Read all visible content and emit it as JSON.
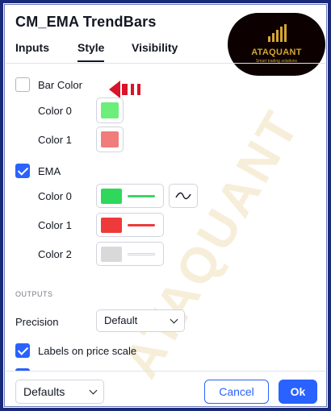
{
  "dialog": {
    "title": "CM_EMA TrendBars"
  },
  "tabs": [
    {
      "label": "Inputs",
      "active": false
    },
    {
      "label": "Style",
      "active": true
    },
    {
      "label": "Visibility",
      "active": false
    }
  ],
  "logo": {
    "name": "ATAQUANT",
    "tagline": "Smart trading solutions"
  },
  "watermark": "ATAQUANT",
  "bar_color": {
    "label": "Bar Color",
    "checked": false,
    "colors": [
      {
        "label": "Color 0",
        "value": "#6bef7a"
      },
      {
        "label": "Color 1",
        "value": "#f07c7c"
      }
    ]
  },
  "ema": {
    "label": "EMA",
    "checked": true,
    "colors": [
      {
        "label": "Color 0",
        "value": "#2ed85a",
        "line": "#3cd46a"
      },
      {
        "label": "Color 1",
        "value": "#ee3a3a",
        "line": "#ee3a3a"
      },
      {
        "label": "Color 2",
        "value": "#d9d9d9",
        "line": "#e5e5e5"
      }
    ],
    "style_icon": "line-style-icon"
  },
  "outputs": {
    "section_label": "OUTPUTS",
    "precision_label": "Precision",
    "precision_value": "Default",
    "labels_on_price_scale": {
      "label": "Labels on price scale",
      "checked": true
    }
  },
  "footer": {
    "defaults_label": "Defaults",
    "cancel_label": "Cancel",
    "ok_label": "Ok"
  },
  "colors": {
    "accent": "#2962ff",
    "annotation_arrow": "#d9142a",
    "frame": "#1a2a7a",
    "logo_gold": "#d4a531"
  }
}
